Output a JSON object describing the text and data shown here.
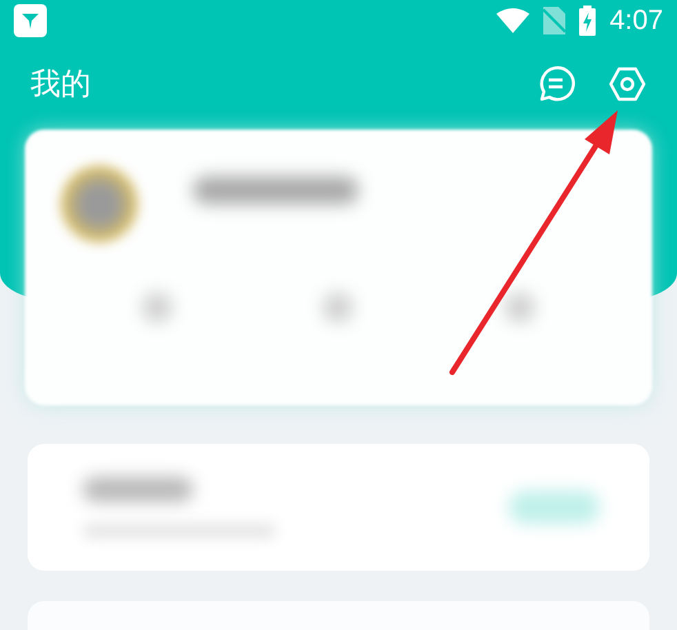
{
  "status_bar": {
    "time": "4:07"
  },
  "header": {
    "title": "我的"
  }
}
